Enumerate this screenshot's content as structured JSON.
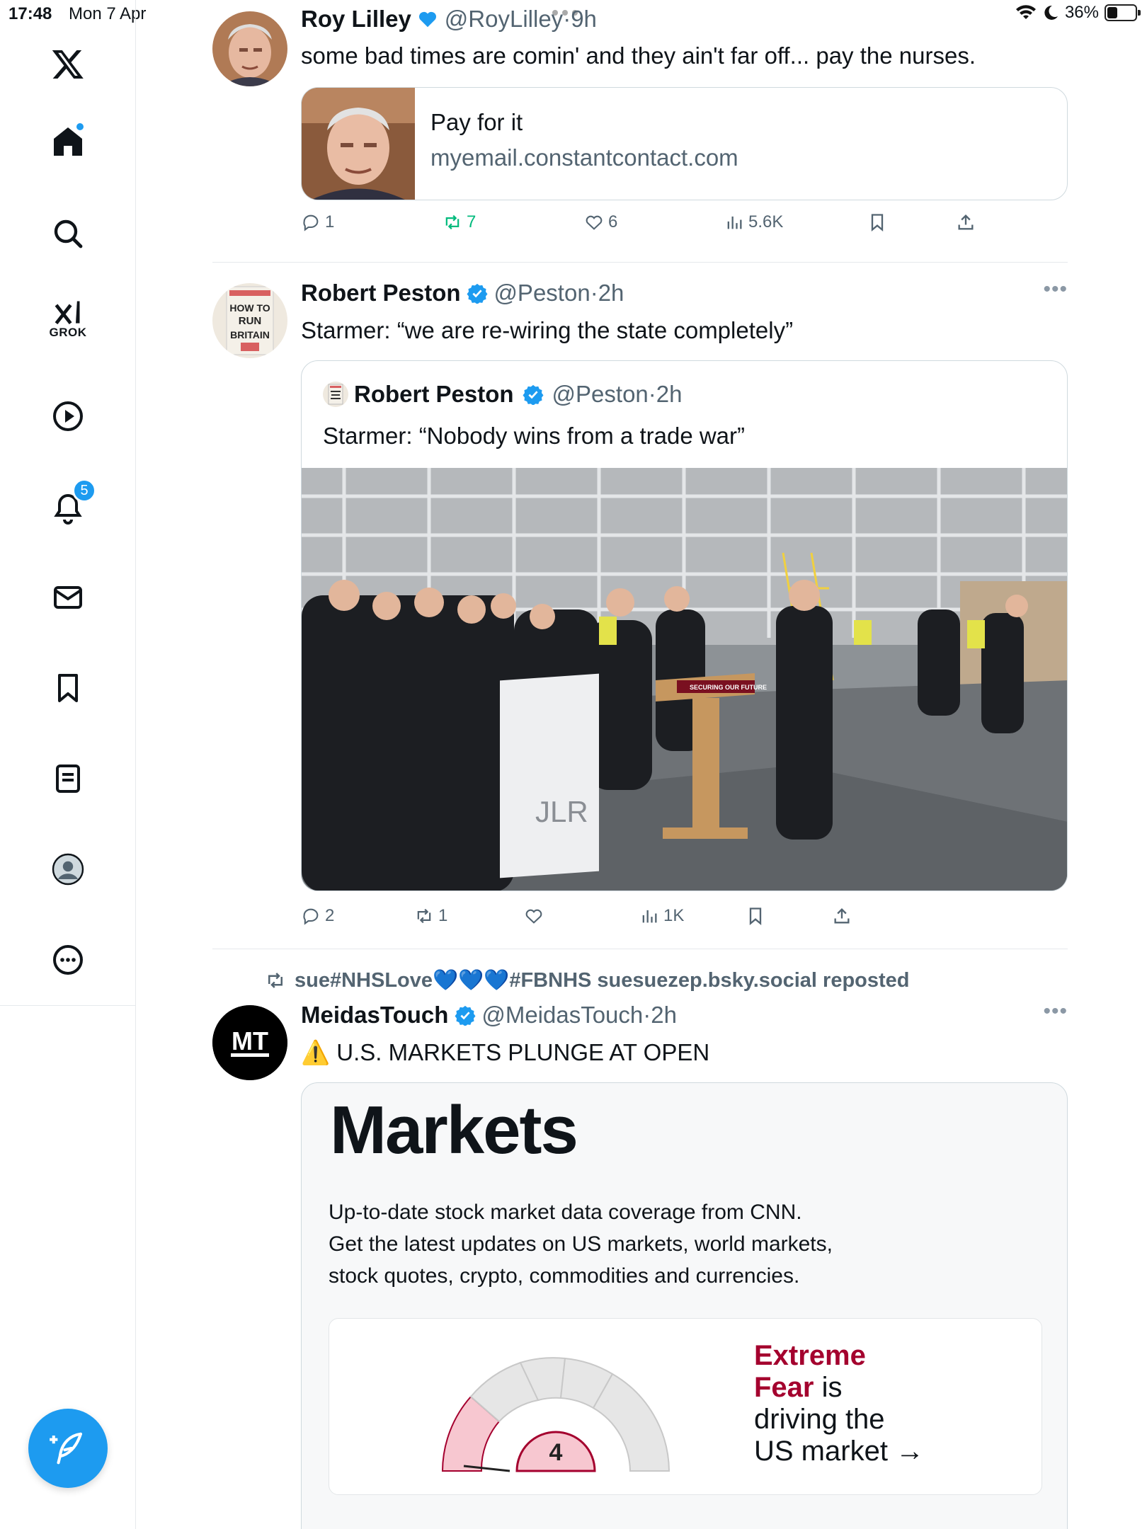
{
  "status_bar": {
    "time": "17:48",
    "date": "Mon 7 Apr",
    "battery": "36%"
  },
  "sidebar": {
    "grok_label": "GROK",
    "notifications_badge": "5"
  },
  "tweets": [
    {
      "name": "Roy Lilley",
      "handle": "@RoyLilley",
      "time": "9h",
      "text": "some bad times are comin' and they ain't far off... pay the nurses.",
      "link_card": {
        "title": "Pay for it",
        "domain": "myemail.constantcontact.com"
      },
      "stats": {
        "replies": "1",
        "reposts": "7",
        "likes": "6",
        "views": "5.6K"
      }
    },
    {
      "name": "Robert Peston",
      "handle": "@Peston",
      "time": "2h",
      "text": "Starmer: “we are re-wiring the state completely”",
      "quote": {
        "name": "Robert Peston",
        "handle": "@Peston",
        "time": "2h",
        "text": "Starmer: “Nobody wins from a trade war”",
        "lectern_text": "SECURING OUR FUTURE",
        "podium_logo": "JLR"
      },
      "stats": {
        "replies": "2",
        "reposts": "1",
        "views": "1K"
      }
    },
    {
      "repost_by": "sue#NHSLove💙💙💙#FBNHS suesuezep.bsky.social reposted",
      "name": "MeidasTouch",
      "handle": "@MeidasTouch",
      "time": "2h",
      "warning_emoji": "⚠️",
      "text": "U.S. MARKETS PLUNGE AT OPEN",
      "avatar_text": "MT",
      "card": {
        "title": "Markets",
        "desc_lines": [
          "Up-to-date stock market data coverage from CNN.",
          "Get the latest updates on US markets, world markets,",
          "stock quotes, crypto, commodities and currencies."
        ],
        "gauge_value": "4",
        "gauge_text_em1": "Extreme",
        "gauge_text_em2": "Fear",
        "gauge_text_rest1": " is",
        "gauge_text_rest2": "driving the",
        "gauge_text_rest3": "US market",
        "gauge_arrow": "→"
      }
    }
  ],
  "separator_dot": "·"
}
